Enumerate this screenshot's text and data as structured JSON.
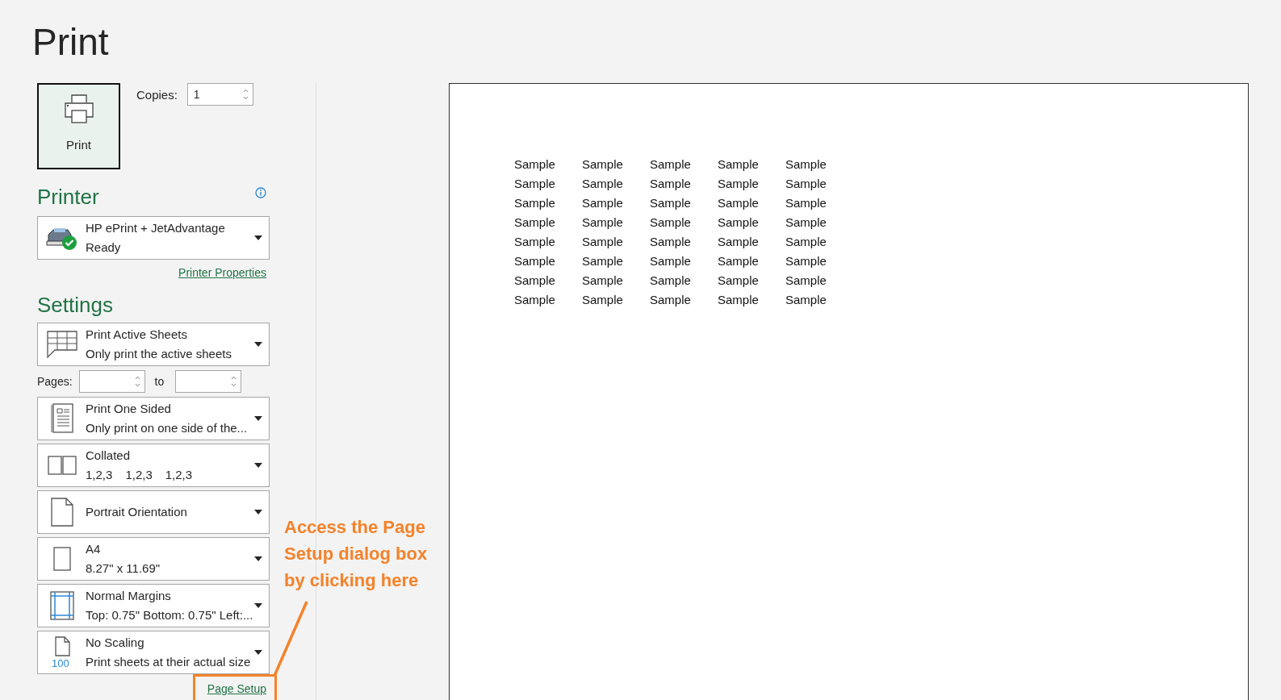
{
  "title": "Print",
  "print_button": {
    "label": "Print"
  },
  "copies": {
    "label": "Copies:",
    "value": "1"
  },
  "printer": {
    "heading": "Printer",
    "name": "HP ePrint + JetAdvantage",
    "status": "Ready",
    "properties_link": "Printer Properties"
  },
  "settings": {
    "heading": "Settings",
    "pages": {
      "label": "Pages:",
      "to_label": "to"
    },
    "options": [
      {
        "kind": "sheets",
        "title": "Print Active Sheets",
        "subtitle": "Only print the active sheets"
      },
      {
        "kind": "sides",
        "title": "Print One Sided",
        "subtitle": "Only print on one side of the..."
      },
      {
        "kind": "collate",
        "title": "Collated",
        "subtitle_parts": [
          "1,2,3",
          "1,2,3",
          "1,2,3"
        ]
      },
      {
        "kind": "orientation",
        "title": "Portrait Orientation"
      },
      {
        "kind": "paper",
        "title": "A4",
        "subtitle": "8.27\" x 11.69\""
      },
      {
        "kind": "margins",
        "title": "Normal Margins",
        "subtitle": "Top: 0.75\" Bottom: 0.75\" Left:..."
      },
      {
        "kind": "scaling",
        "title": "No Scaling",
        "subtitle": "Print sheets at their actual size",
        "icon_text": "100"
      }
    ],
    "page_setup_link": "Page Setup"
  },
  "preview": {
    "rows": [
      [
        "Sample",
        "Sample",
        "Sample",
        "Sample",
        "Sample"
      ],
      [
        "Sample",
        "Sample",
        "Sample",
        "Sample",
        "Sample"
      ],
      [
        "Sample",
        "Sample",
        "Sample",
        "Sample",
        "Sample"
      ],
      [
        "Sample",
        "Sample",
        "Sample",
        "Sample",
        "Sample"
      ],
      [
        "Sample",
        "Sample",
        "Sample",
        "Sample",
        "Sample"
      ],
      [
        "Sample",
        "Sample",
        "Sample",
        "Sample",
        "Sample"
      ],
      [
        "Sample",
        "Sample",
        "Sample",
        "Sample",
        "Sample"
      ],
      [
        "Sample",
        "Sample",
        "Sample",
        "Sample",
        "Sample"
      ]
    ]
  },
  "annotation": {
    "lines": [
      "Access the Page",
      "Setup dialog box",
      "by clicking here"
    ]
  }
}
